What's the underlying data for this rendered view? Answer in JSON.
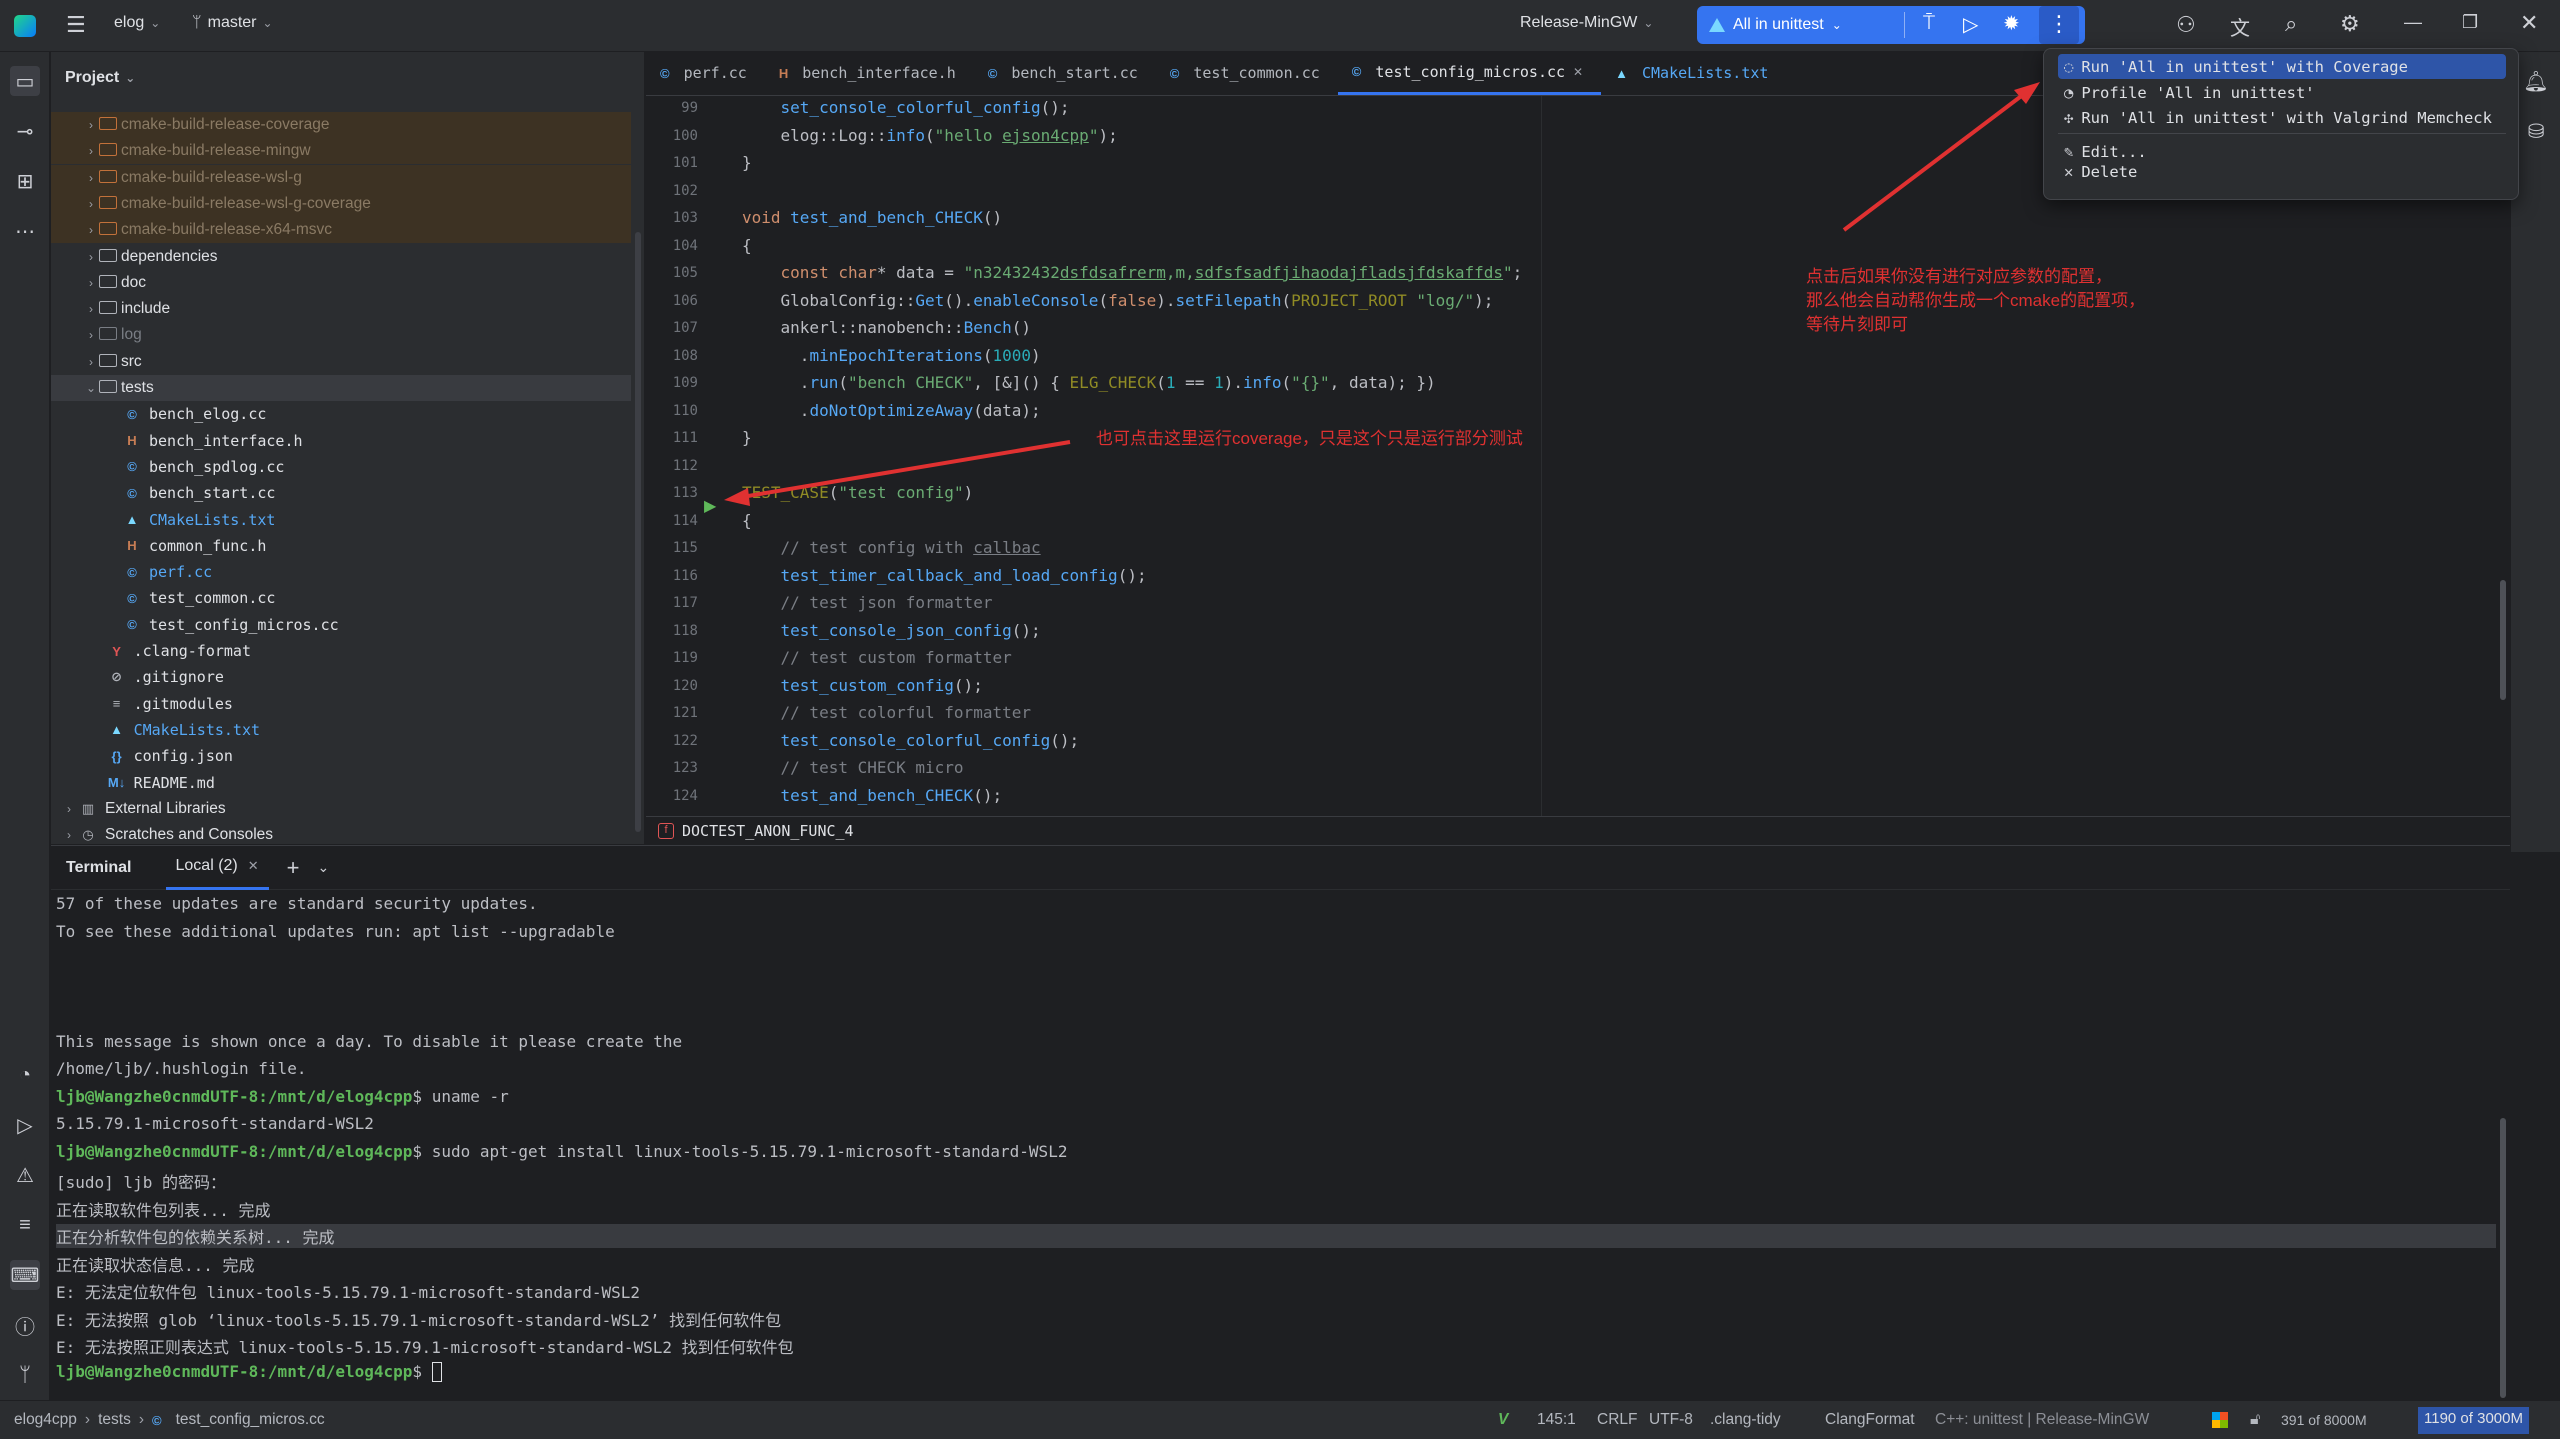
{
  "titlebar": {
    "project": "elog",
    "branch": "master",
    "run_config": "Release-MinGW",
    "target": "All in unittest"
  },
  "project_panel": {
    "title": "Project",
    "items": [
      {
        "label": "cmake-build-release-coverage",
        "kind": "excluded",
        "depth": 1,
        "chev": "›"
      },
      {
        "label": "cmake-build-release-mingw",
        "kind": "excluded",
        "depth": 1,
        "chev": "›"
      },
      {
        "label": "cmake-build-release-wsl-g",
        "kind": "excluded",
        "depth": 1,
        "chev": "›"
      },
      {
        "label": "cmake-build-release-wsl-g-coverage",
        "kind": "excluded",
        "depth": 1,
        "chev": "›"
      },
      {
        "label": "cmake-build-release-x64-msvc",
        "kind": "excluded",
        "depth": 1,
        "chev": "›"
      },
      {
        "label": "dependencies",
        "kind": "folder",
        "depth": 1,
        "chev": "›"
      },
      {
        "label": "doc",
        "kind": "folder",
        "depth": 1,
        "chev": "›"
      },
      {
        "label": "include",
        "kind": "folder",
        "depth": 1,
        "chev": "›"
      },
      {
        "label": "log",
        "kind": "folder-dim",
        "depth": 1,
        "chev": "›"
      },
      {
        "label": "src",
        "kind": "folder",
        "depth": 1,
        "chev": "›"
      },
      {
        "label": "tests",
        "kind": "folder-open",
        "depth": 1,
        "chev": "⌄"
      },
      {
        "label": "bench_elog.cc",
        "kind": "cc",
        "depth": 2,
        "chev": ""
      },
      {
        "label": "bench_interface.h",
        "kind": "h",
        "depth": 2,
        "chev": ""
      },
      {
        "label": "bench_spdlog.cc",
        "kind": "cc",
        "depth": 2,
        "chev": ""
      },
      {
        "label": "bench_start.cc",
        "kind": "cc",
        "depth": 2,
        "chev": ""
      },
      {
        "label": "CMakeLists.txt",
        "kind": "cmake",
        "depth": 2,
        "chev": ""
      },
      {
        "label": "common_func.h",
        "kind": "h",
        "depth": 2,
        "chev": ""
      },
      {
        "label": "perf.cc",
        "kind": "cc",
        "depth": 2,
        "chev": ""
      },
      {
        "label": "test_common.cc",
        "kind": "cc",
        "depth": 2,
        "chev": ""
      },
      {
        "label": "test_config_micros.cc",
        "kind": "cc",
        "depth": 2,
        "chev": ""
      },
      {
        "label": ".clang-format",
        "kind": "yml",
        "depth": 1.3,
        "chev": ""
      },
      {
        "label": ".gitignore",
        "kind": "ignore",
        "depth": 1.3,
        "chev": ""
      },
      {
        "label": ".gitmodules",
        "kind": "text",
        "depth": 1.3,
        "chev": ""
      },
      {
        "label": "CMakeLists.txt",
        "kind": "cmake",
        "depth": 1.3,
        "chev": ""
      },
      {
        "label": "config.json",
        "kind": "json",
        "depth": 1.3,
        "chev": ""
      },
      {
        "label": "README.md",
        "kind": "md",
        "depth": 1.3,
        "chev": ""
      },
      {
        "label": "External Libraries",
        "kind": "lib",
        "depth": 0,
        "chev": "›"
      },
      {
        "label": "Scratches and Consoles",
        "kind": "scratch",
        "depth": 0,
        "chev": "›"
      }
    ]
  },
  "editor_tabs": [
    {
      "label": "perf.cc",
      "icon": "cc",
      "active": false
    },
    {
      "label": "bench_interface.h",
      "icon": "h",
      "active": false
    },
    {
      "label": "bench_start.cc",
      "icon": "cc",
      "active": false
    },
    {
      "label": "test_common.cc",
      "icon": "cc",
      "active": false
    },
    {
      "label": "test_config_micros.cc",
      "icon": "cc",
      "active": true
    },
    {
      "label": "CMakeLists.txt",
      "icon": "cmake",
      "active": false
    }
  ],
  "code_lines": [
    {
      "n": "99",
      "html": "    <span class='fn'>set_console_colorful_config</span>();"
    },
    {
      "n": "100",
      "html": "    elog::Log::<span class='fn'>info</span>(<span class='str'>\"hello <u>ejson4cpp</u>\"</span>);"
    },
    {
      "n": "101",
      "html": "}"
    },
    {
      "n": "102",
      "html": ""
    },
    {
      "n": "103",
      "html": "<span class='kw'>void</span> <span class='fn'>test_and_bench_CHECK</span>()"
    },
    {
      "n": "104",
      "html": "{"
    },
    {
      "n": "105",
      "html": "    <span class='kw'>const char</span>* data = <span class='str'>\"n32432432<u>dsfdsafrerm</u>,m,<u>sdfsfsadfjihaodajfladsjfdskaffds</u>\"</span>;"
    },
    {
      "n": "106",
      "html": "    GlobalConfig::<span class='fn'>Get</span>().<span class='fn'>enableConsole</span>(<span class='kw'>false</span>).<span class='fn'>setFilepath</span>(<span class='mac'>PROJECT_ROOT</span> <span class='str'>\"log/\"</span>);"
    },
    {
      "n": "107",
      "html": "    ankerl::nanobench::<span class='fn'>Bench</span>()"
    },
    {
      "n": "108",
      "html": "      .<span class='fn'>minEpochIterations</span>(<span class='num'>1000</span>)"
    },
    {
      "n": "109",
      "html": "      .<span class='fn'>run</span>(<span class='str'>\"bench CHECK\"</span>, [&amp;]() { <span class='mac'>ELG_CHECK</span>(<span class='num'>1</span> == <span class='num'>1</span>).<span class='fn'>info</span>(<span class='str'>\"{}\"</span>, data); })"
    },
    {
      "n": "110",
      "html": "      .<span class='fn'>doNotOptimizeAway</span>(data);"
    },
    {
      "n": "111",
      "html": "}"
    },
    {
      "n": "112",
      "html": ""
    },
    {
      "n": "113",
      "html": "<span class='mac'>TEST_CASE</span>(<span class='str'>\"test config\"</span>)"
    },
    {
      "n": "114",
      "html": "{"
    },
    {
      "n": "115",
      "html": "    <span class='cm'>// test config with <u>callbac</u></span>"
    },
    {
      "n": "116",
      "html": "    <span class='fn'>test_timer_callback_and_load_config</span>();"
    },
    {
      "n": "117",
      "html": "    <span class='cm'>// test json formatter</span>"
    },
    {
      "n": "118",
      "html": "    <span class='fn'>test_console_json_config</span>();"
    },
    {
      "n": "119",
      "html": "    <span class='cm'>// test custom formatter</span>"
    },
    {
      "n": "120",
      "html": "    <span class='fn'>test_custom_config</span>();"
    },
    {
      "n": "121",
      "html": "    <span class='cm'>// test colorful formatter</span>"
    },
    {
      "n": "122",
      "html": "    <span class='fn'>test_console_colorful_config</span>();"
    },
    {
      "n": "123",
      "html": "    <span class='cm'>// test CHECK micro</span>"
    },
    {
      "n": "124",
      "html": "    <span class='fn'>test_and_bench_CHECK</span>();"
    }
  ],
  "breadcrumb_func": "DOCTEST_ANON_FUNC_4",
  "run_menu": {
    "items": [
      {
        "label": "Run 'All in unittest' with Coverage",
        "icon": "coverage-icon",
        "selected": true
      },
      {
        "label": "Profile 'All in unittest'",
        "icon": "profile-icon",
        "selected": false
      },
      {
        "label": "Run 'All in unittest' with Valgrind Memcheck",
        "icon": "valgrind-icon",
        "selected": false
      },
      {
        "label": "Edit...",
        "icon": "edit-icon",
        "selected": false
      },
      {
        "label": "Delete",
        "icon": "delete-icon",
        "selected": false
      }
    ]
  },
  "annotations": {
    "note_right": [
      "点击后如果你没有进行对应参数的配置，",
      "那么他会自动帮你生成一个cmake的配置项，",
      "等待片刻即可"
    ],
    "note_gutter": "也可点击这里运行coverage，只是这个只是运行部分测试"
  },
  "terminal": {
    "title": "Terminal",
    "tab": "Local (2)",
    "lines": [
      {
        "text": "57 of these updates are standard security updates.",
        "prompt": ""
      },
      {
        "text": "To see these additional updates run: apt list --upgradable",
        "prompt": ""
      },
      {
        "text": "",
        "prompt": ""
      },
      {
        "text": "",
        "prompt": ""
      },
      {
        "text": "",
        "prompt": ""
      },
      {
        "text": "This message is shown once a day. To disable it please create the",
        "prompt": ""
      },
      {
        "text": "/home/ljb/.hushlogin file.",
        "prompt": ""
      },
      {
        "text": "$ uname -r",
        "prompt": "ljb@Wangzhe0cnmdUTF-8:/mnt/d/elog4cpp"
      },
      {
        "text": "5.15.79.1-microsoft-standard-WSL2",
        "prompt": ""
      },
      {
        "text": "$ sudo apt-get install linux-tools-5.15.79.1-microsoft-standard-WSL2",
        "prompt": "ljb@Wangzhe0cnmdUTF-8:/mnt/d/elog4cpp"
      },
      {
        "text": "[sudo] ljb 的密码：",
        "prompt": ""
      },
      {
        "text": "正在读取软件包列表... 完成",
        "prompt": ""
      },
      {
        "text": "正在分析软件包的依赖关系树... 完成",
        "prompt": ""
      },
      {
        "text": "正在读取状态信息... 完成",
        "prompt": ""
      },
      {
        "text": "E: 无法定位软件包 linux-tools-5.15.79.1-microsoft-standard-WSL2",
        "prompt": ""
      },
      {
        "text": "E: 无法按照 glob ‘linux-tools-5.15.79.1-microsoft-standard-WSL2’ 找到任何软件包",
        "prompt": ""
      },
      {
        "text": "E: 无法按照正则表达式 linux-tools-5.15.79.1-microsoft-standard-WSL2 找到任何软件包",
        "prompt": ""
      },
      {
        "text": "$ ",
        "prompt": "ljb@Wangzhe0cnmdUTF-8:/mnt/d/elog4cpp"
      }
    ]
  },
  "statusbar": {
    "crumbs": [
      "elog4cpp",
      "tests",
      "test_config_micros.cc"
    ],
    "position": "145:1",
    "line_ending": "CRLF",
    "encoding": "UTF-8",
    "linter": ".clang-tidy",
    "formatter": "ClangFormat",
    "context": "C++: unittest | Release-MinGW",
    "memory": "391 of 8000M",
    "memory2": "1190 of 3000M"
  },
  "colors": {
    "accent": "#3574f0",
    "annotation": "#e03131",
    "prompt": "#5fb85a"
  }
}
